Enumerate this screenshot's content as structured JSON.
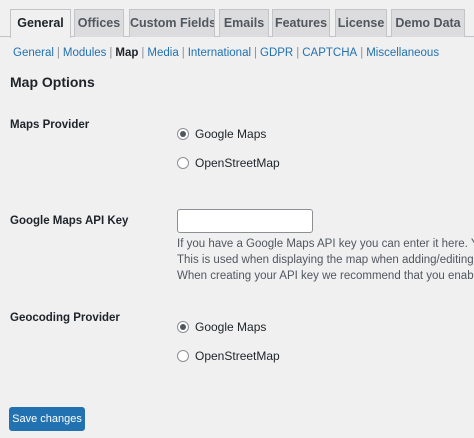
{
  "tabs": [
    {
      "label": "General"
    },
    {
      "label": "Offices"
    },
    {
      "label": "Custom Fields"
    },
    {
      "label": "Emails"
    },
    {
      "label": "Features"
    },
    {
      "label": "License"
    },
    {
      "label": "Demo Data"
    }
  ],
  "subnav": {
    "items": [
      "General",
      "Modules",
      "Map",
      "Media",
      "International",
      "GDPR",
      "CAPTCHA",
      "Miscellaneous"
    ],
    "separator": "|"
  },
  "section_title": "Map Options",
  "maps_provider": {
    "label": "Maps Provider",
    "options": [
      "Google Maps",
      "OpenStreetMap"
    ],
    "selected": "Google Maps"
  },
  "api_key": {
    "label": "Google Maps API Key",
    "value": "",
    "description": [
      "If you have a Google Maps API key you can enter it here. You ca",
      "This is used when displaying the map when adding/editing pro",
      "When creating your API key we recommend that you enable the"
    ]
  },
  "geocoding_provider": {
    "label": "Geocoding Provider",
    "options": [
      "Google Maps",
      "OpenStreetMap"
    ],
    "selected": "Google Maps"
  },
  "save_label": "Save changes",
  "colors": {
    "accent": "#2271b1",
    "background": "#f0f0f1",
    "tab_inactive": "#dcdcde"
  }
}
